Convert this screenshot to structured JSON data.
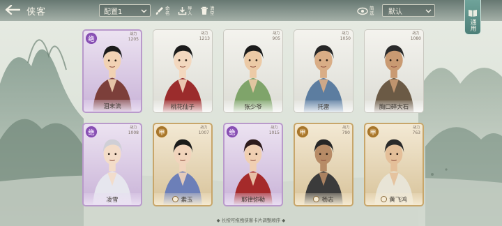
{
  "header": {
    "title": "侠客",
    "preset_value": "配置1",
    "sort_value": "默认"
  },
  "toolbar": [
    {
      "name": "edit-button",
      "label": "命名",
      "icon": "brush-icon"
    },
    {
      "name": "import-button",
      "label": "导入",
      "icon": "download-icon"
    },
    {
      "name": "clear-button",
      "label": "清空",
      "icon": "trash-icon"
    }
  ],
  "filter": {
    "label": "简选",
    "icon": "eye-icon"
  },
  "general_tab": {
    "label": "通用"
  },
  "cards": [
    {
      "name": "泪末流",
      "tier": "绝",
      "rarity": "purple",
      "power_label": "战力",
      "power": "1205"
    },
    {
      "name": "桃花仙子",
      "tier": "",
      "rarity": "white",
      "power_label": "战力",
      "power": "1213"
    },
    {
      "name": "张少爷",
      "tier": "",
      "rarity": "white",
      "power_label": "战力",
      "power": "905"
    },
    {
      "name": "托雷",
      "tier": "",
      "rarity": "white",
      "power_label": "战力",
      "power": "1050"
    },
    {
      "name": "胸口碎大石",
      "tier": "",
      "rarity": "white",
      "power_label": "战力",
      "power": "1080"
    },
    {
      "name": "凌雪",
      "tier": "绝",
      "rarity": "purple",
      "power_label": "战力",
      "power": "1008"
    },
    {
      "name": "素玉",
      "tier": "甲",
      "rarity": "gold",
      "power_label": "战力",
      "power": "1007"
    },
    {
      "name": "耶律弥勒",
      "tier": "绝",
      "rarity": "purple",
      "power_label": "战力",
      "power": "1015"
    },
    {
      "name": "杨志",
      "tier": "甲",
      "rarity": "gold",
      "power_label": "战力",
      "power": "790"
    },
    {
      "name": "黄飞鸿",
      "tier": "甲",
      "rarity": "gold",
      "power_label": "战力",
      "power": "763"
    }
  ],
  "hint": "◆ 长按可拖拽侠客卡片调整顺序 ◆"
}
